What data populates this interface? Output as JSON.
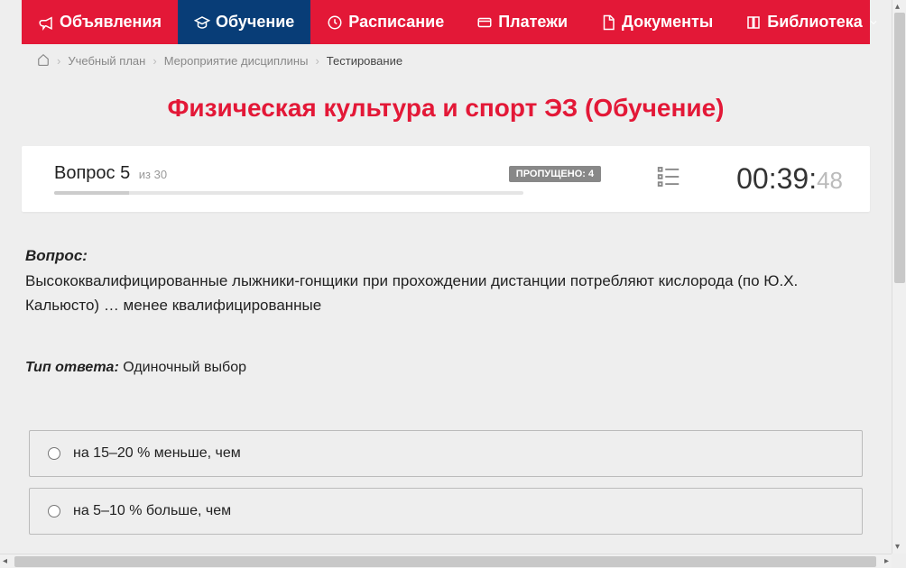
{
  "nav": {
    "items": [
      {
        "label": "Объявления",
        "icon": "megaphone"
      },
      {
        "label": "Обучение",
        "icon": "graduation-cap",
        "active": true
      },
      {
        "label": "Расписание",
        "icon": "clock"
      },
      {
        "label": "Платежи",
        "icon": "credit-card"
      },
      {
        "label": "Документы",
        "icon": "file"
      },
      {
        "label": "Библиотека",
        "icon": "book",
        "chevron": true
      }
    ]
  },
  "breadcrumb": {
    "home_icon": "home",
    "items": [
      "Учебный план",
      "Мероприятие дисциплины",
      "Тестирование"
    ]
  },
  "page": {
    "title": "Физическая культура и спорт ЭЗ (Обучение)"
  },
  "status": {
    "question_label": "Вопрос",
    "question_current": "5",
    "question_of": "из",
    "question_total": "30",
    "skipped_label": "ПРОПУЩЕНО:",
    "skipped_count": "4",
    "progress_percent": 16
  },
  "timer": {
    "main": "00:39:",
    "seconds": "48"
  },
  "question": {
    "label": "Вопрос:",
    "text": "Высококвалифицированные лыжники-гонщики при прохождении дистанции потребляют кислорода (по Ю.Х. Кальюсто) … менее квалифицированные"
  },
  "answer_type": {
    "label": "Тип ответа:",
    "value": "Одиночный выбор"
  },
  "options": [
    {
      "text": "на 15–20 % меньше, чем"
    },
    {
      "text": "на 5–10 % больше, чем"
    }
  ]
}
